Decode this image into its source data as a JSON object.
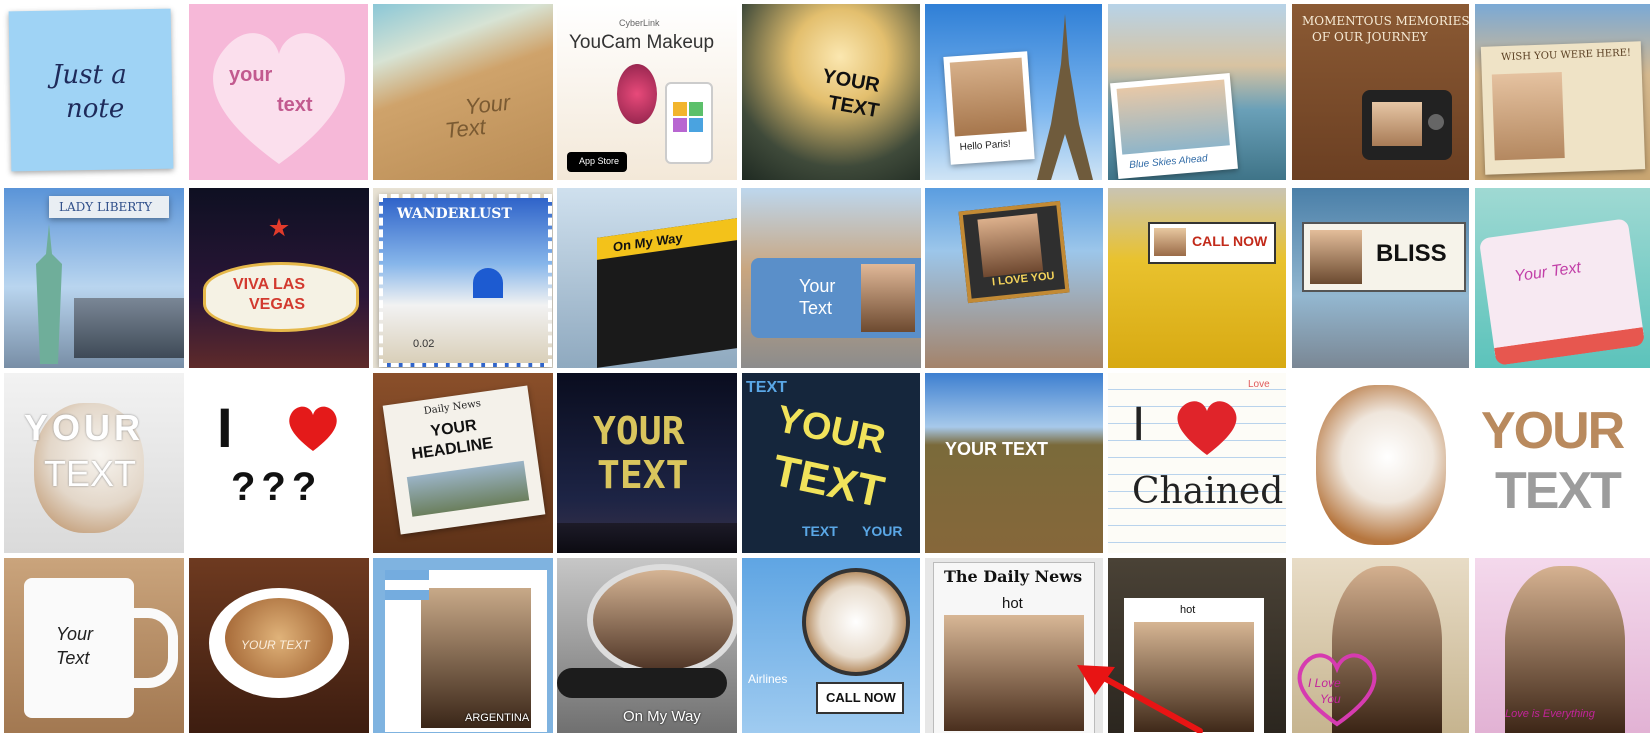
{
  "tiles": [
    {
      "key": "note",
      "text": [
        "Just a",
        "note"
      ]
    },
    {
      "key": "heart_words",
      "text": [
        "your",
        "text"
      ]
    },
    {
      "key": "sand",
      "text": [
        "Your",
        "Text"
      ]
    },
    {
      "key": "youcam",
      "text": [
        "CyberLink",
        "YouCam Makeup",
        "App Store"
      ]
    },
    {
      "key": "sign_hands",
      "text": [
        "YOUR",
        "TEXT"
      ]
    },
    {
      "key": "eiffel",
      "text": [
        "Hello Paris!"
      ]
    },
    {
      "key": "canal",
      "text": [
        "Blue Skies Ahead"
      ]
    },
    {
      "key": "memories",
      "text": [
        "MOMENTOUS MEMORIES",
        "OF OUR JOURNEY"
      ]
    },
    {
      "key": "postcard",
      "text": [
        "WISH YOU WERE HERE!"
      ]
    },
    {
      "key": "liberty",
      "text": [
        "LADY LIBERTY"
      ]
    },
    {
      "key": "vegas",
      "text": [
        "VIVA LAS",
        "VEGAS"
      ]
    },
    {
      "key": "wanderlust",
      "text": [
        "WANDERLUST",
        "0.02"
      ]
    },
    {
      "key": "board",
      "text": [
        "On My Way"
      ]
    },
    {
      "key": "tram",
      "text": [
        "Your",
        "Text"
      ]
    },
    {
      "key": "billboard_brick",
      "text": [
        "I LOVE YOU"
      ]
    },
    {
      "key": "taxi",
      "text": [
        "CALL NOW"
      ]
    },
    {
      "key": "bliss",
      "text": [
        "BLISS"
      ]
    },
    {
      "key": "cake",
      "text": [
        "Your Text"
      ]
    },
    {
      "key": "dog_text",
      "text": [
        "YOUR",
        "TEXT"
      ]
    },
    {
      "key": "i_heart",
      "text": [
        "I",
        "???"
      ]
    },
    {
      "key": "headline",
      "text": [
        "Daily News",
        "YOUR",
        "HEADLINE"
      ]
    },
    {
      "key": "fireworks",
      "text": [
        "YOUR",
        "TEXT"
      ]
    },
    {
      "key": "typography",
      "text": [
        "TEXT",
        "YOUR",
        "TEXT",
        "YOUR",
        "TEXT"
      ]
    },
    {
      "key": "hollywood",
      "text": [
        "YOUR TEXT"
      ]
    },
    {
      "key": "chained",
      "text": [
        "I",
        "Chained",
        "Love"
      ]
    },
    {
      "key": "dog",
      "text": []
    },
    {
      "key": "cutout_text",
      "text": [
        "YOUR",
        "TEXT"
      ]
    },
    {
      "key": "mug",
      "text": [
        "Your",
        "Text"
      ]
    },
    {
      "key": "latte",
      "text": [
        "YOUR TEXT"
      ]
    },
    {
      "key": "argentina",
      "text": [
        "ARGENTINA"
      ]
    },
    {
      "key": "mirror",
      "text": [
        "On My Way"
      ]
    },
    {
      "key": "dog_circle",
      "text": [
        "CALL NOW",
        "Airlines"
      ]
    },
    {
      "key": "newspaper",
      "text": [
        "The Daily News",
        "hot"
      ]
    },
    {
      "key": "printer",
      "text": [
        "hot"
      ]
    },
    {
      "key": "portrait_heart",
      "text": [
        "I Love",
        "You"
      ]
    },
    {
      "key": "portrait_pink",
      "text": [
        "Love is Everything"
      ]
    }
  ],
  "colors": {
    "arrow": "#e81414",
    "note_bg": "#9fd3f5",
    "note_ink": "#1e2a5a",
    "heart_pink": "#f6b8d8",
    "sky": "#58a3e6"
  },
  "pointer": {
    "icon": "red-arrow-icon",
    "target": "newspaper"
  }
}
